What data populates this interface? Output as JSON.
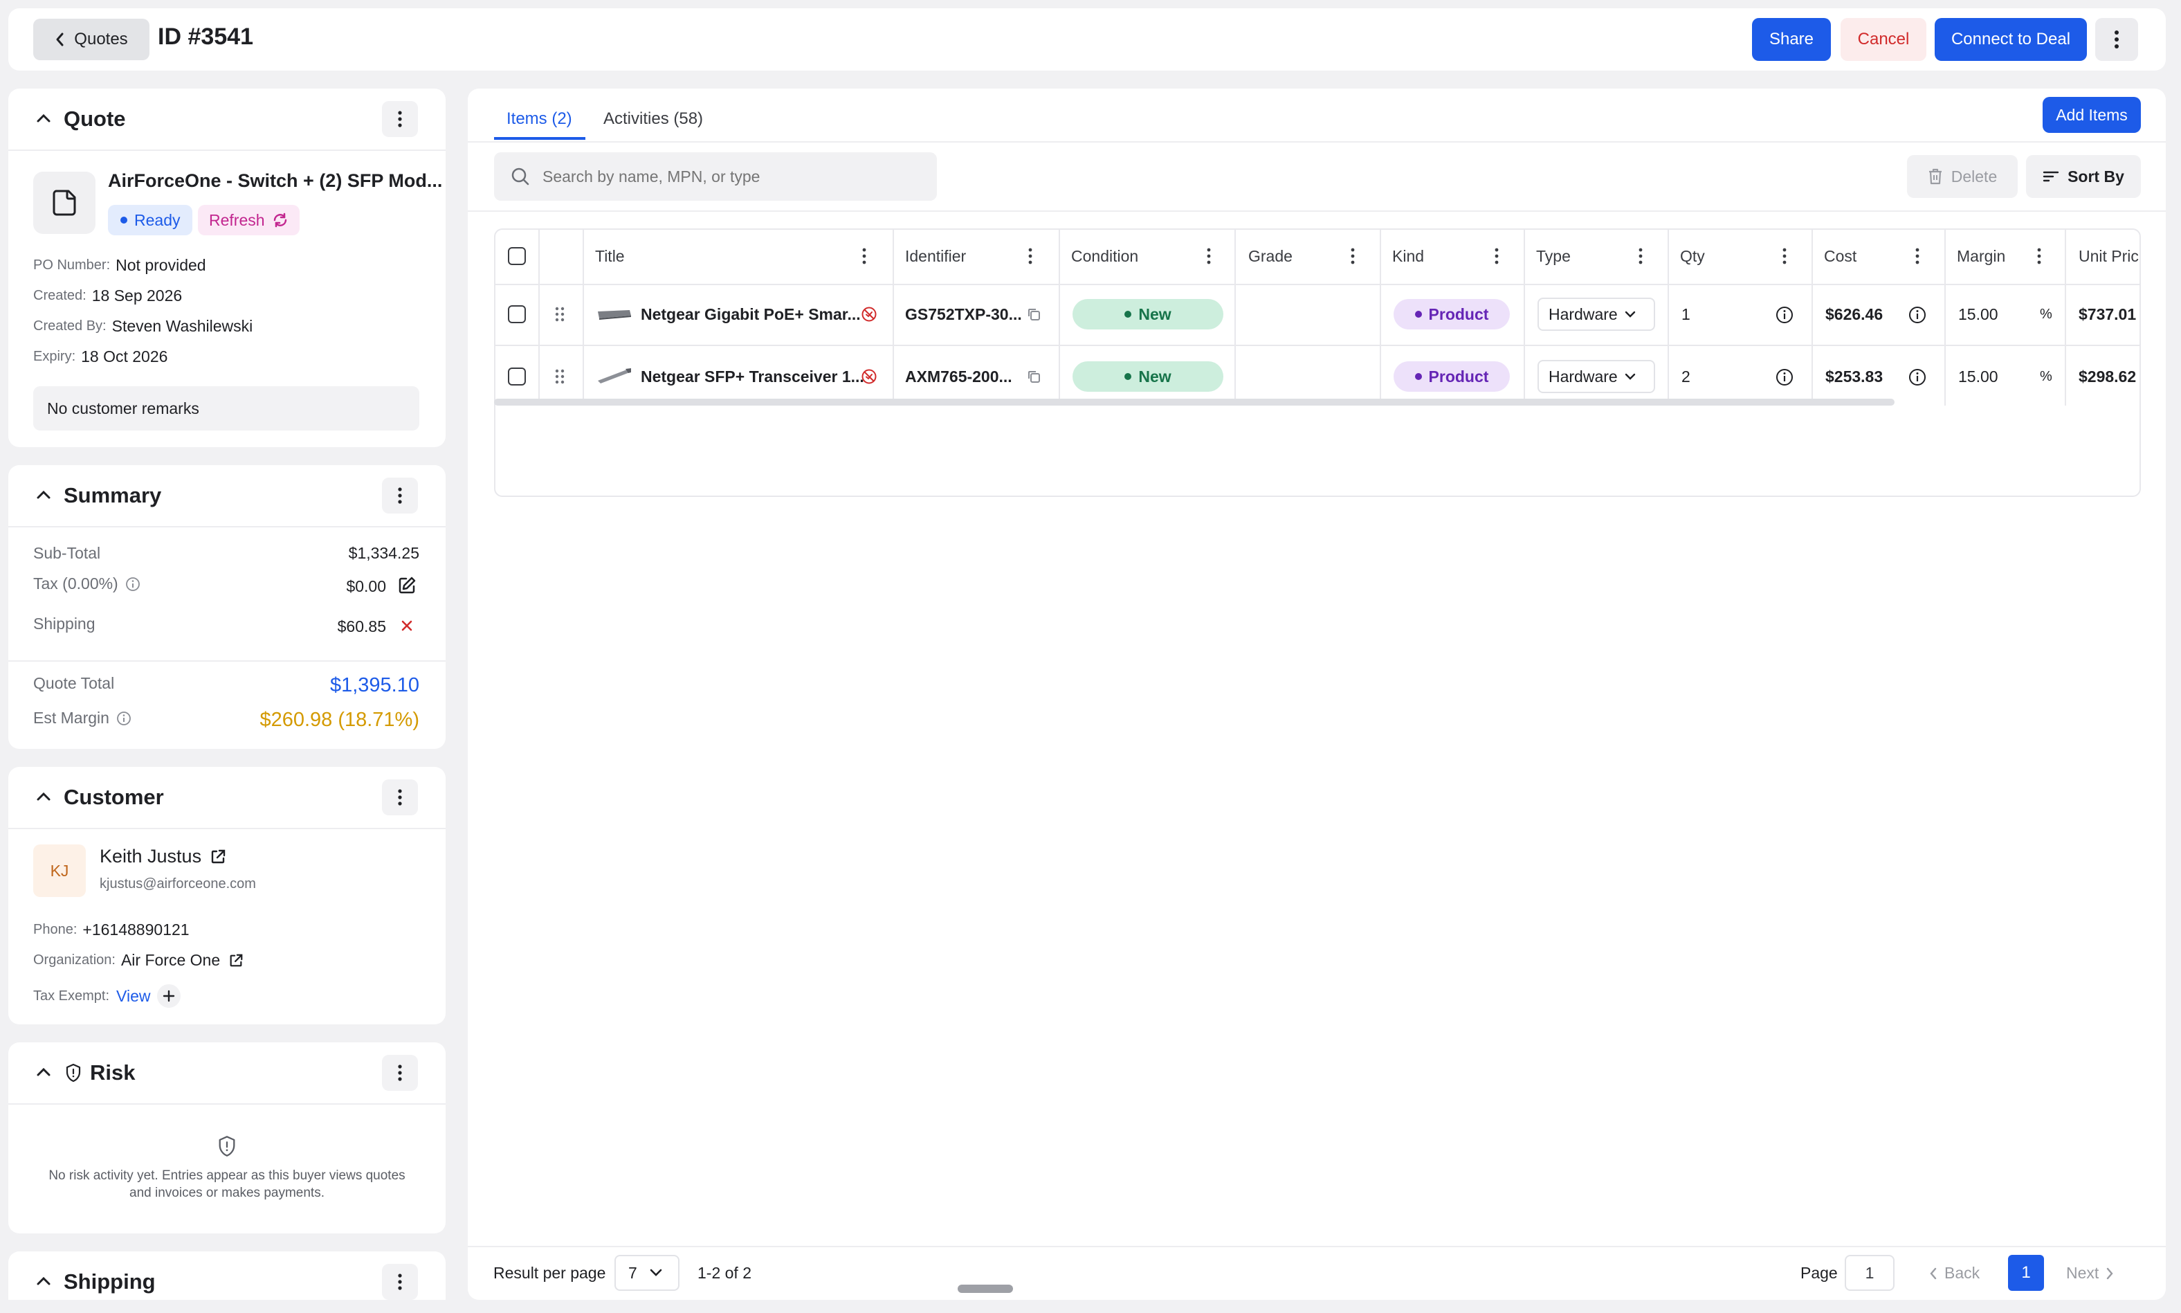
{
  "header": {
    "back_label": "Quotes",
    "quote_id": "ID #3541",
    "share_label": "Share",
    "cancel_label": "Cancel",
    "connect_label": "Connect to Deal"
  },
  "quote": {
    "section_title": "Quote",
    "name": "AirForceOne - Switch + (2) SFP Mod...",
    "status": "Ready",
    "refresh_label": "Refresh",
    "po_label": "PO Number:",
    "po_value": "Not provided",
    "created_label": "Created:",
    "created_value": "18 Sep 2026",
    "created_by_label": "Created By:",
    "created_by_value": "Steven Washilewski",
    "expiry_label": "Expiry:",
    "expiry_value": "18 Oct 2026",
    "remarks": "No customer remarks"
  },
  "summary": {
    "section_title": "Summary",
    "subtotal_label": "Sub-Total",
    "subtotal_value": "$1,334.25",
    "tax_label": "Tax (0.00%)",
    "tax_value": "$0.00",
    "shipping_label": "Shipping",
    "shipping_value": "$60.85",
    "total_label": "Quote Total",
    "total_value": "$1,395.10",
    "margin_label": "Est Margin",
    "margin_value": "$260.98 (18.71%)"
  },
  "customer": {
    "section_title": "Customer",
    "initials": "KJ",
    "name": "Keith Justus",
    "email": "kjustus@airforceone.com",
    "phone_label": "Phone:",
    "phone_value": "+16148890121",
    "org_label": "Organization:",
    "org_value": "Air Force One",
    "tax_exempt_label": "Tax Exempt:",
    "tax_exempt_link": "View"
  },
  "risk": {
    "section_title": "Risk",
    "empty_line1": "No risk activity yet. Entries appear as this buyer views quotes",
    "empty_line2": "and invoices or makes payments."
  },
  "shipping_section": {
    "section_title": "Shipping"
  },
  "tabs": [
    {
      "label": "Items (2)",
      "active": true
    },
    {
      "label": "Activities (58)",
      "active": false
    }
  ],
  "toolbar": {
    "add_items_label": "Add Items",
    "search_placeholder": "Search by name, MPN, or type",
    "delete_label": "Delete",
    "sort_label": "Sort By"
  },
  "table": {
    "columns": [
      "Title",
      "Identifier",
      "Condition",
      "Grade",
      "Kind",
      "Type",
      "Qty",
      "Cost",
      "Margin",
      "Unit Pric"
    ],
    "rows": [
      {
        "title": "Netgear Gigabit PoE+ Smar...",
        "identifier": "GS752TXP-30...",
        "condition": "New",
        "grade": "",
        "kind": "Product",
        "type": "Hardware",
        "qty": "1",
        "cost": "$626.46",
        "margin": "15.00",
        "margin_unit": "%",
        "unit_price": "$737.01"
      },
      {
        "title": "Netgear SFP+ Transceiver 1...",
        "identifier": "AXM765-200...",
        "condition": "New",
        "grade": "",
        "kind": "Product",
        "type": "Hardware",
        "qty": "2",
        "cost": "$253.83",
        "margin": "15.00",
        "margin_unit": "%",
        "unit_price": "$298.62"
      }
    ]
  },
  "footer": {
    "result_per_page_label": "Result per page",
    "per_page_value": "7",
    "range_text": "1-2 of 2",
    "page_label": "Page",
    "page_input_value": "1",
    "back_label": "Back",
    "current_page": "1",
    "next_label": "Next"
  },
  "colors": {
    "primary": "#1d5be8",
    "danger": "#d12b2b",
    "total_blue": "#1d5be8",
    "margin_gold": "#d49a00",
    "success_bg": "#cdeedd",
    "product_bg": "#ede1fa"
  }
}
